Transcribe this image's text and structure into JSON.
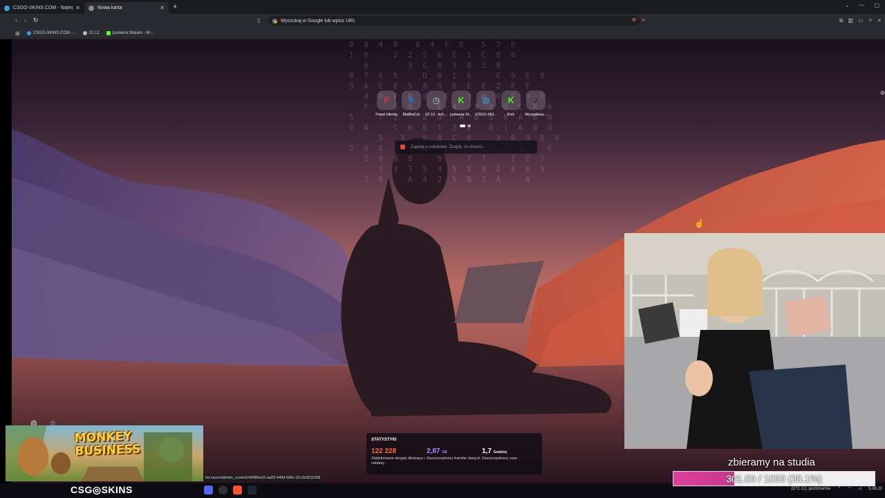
{
  "browser": {
    "tabs": [
      {
        "title": "CSGO-SKINS.COM - Najlepsze Skrzy...",
        "color": "#3ba0e0"
      },
      {
        "title": "Nowa karta",
        "color": "#888888"
      }
    ],
    "address_placeholder": "Wyszukaj w Google lub wpisz URL",
    "bookmarks": [
      {
        "label": "CSGO-SKINS.COM -...",
        "color": "#3ba0e0"
      },
      {
        "label": "22.12",
        "color": "#bbbbbb"
      },
      {
        "label": "justwera Stream - W...",
        "color": "#53fc18"
      }
    ]
  },
  "newtab": {
    "shortcuts": [
      {
        "label": "Panel klienta",
        "glyph": "P",
        "color": "#d9344a"
      },
      {
        "label": "BlaBlaCar",
        "glyph": "b",
        "color": "#1e7bd8"
      },
      {
        "label": "22.12 - lich...",
        "glyph": "◷",
        "color": "#9aa0a8"
      },
      {
        "label": "justwera St...",
        "glyph": "K",
        "color": "#53fc18"
      },
      {
        "label": "CSGO-SKI...",
        "glyph": "◎",
        "color": "#3ba0e0"
      },
      {
        "label": "Kick",
        "glyph": "K",
        "color": "#53fc18"
      },
      {
        "label": "Wyszukiwa...",
        "glyph": "♪",
        "color": "#111111"
      }
    ],
    "search_placeholder": "Zapytaj o cokolwiek. Znajdź, co chcesz...",
    "stats": {
      "heading": "STATYSTYKI",
      "items": [
        {
          "value": "122 228",
          "unit": "",
          "desc": "Zablokowane skrypty śledzące i reklamy",
          "color": "#ff6a2a"
        },
        {
          "value": "2,87",
          "unit": "GB",
          "desc": "Zaoszczędzony transfer danych",
          "color": "#a48bff"
        },
        {
          "value": "1,7",
          "unit": "Godziny",
          "desc": "Zaoszczędzony czas",
          "color": "#ffffff"
        }
      ]
    }
  },
  "ad": {
    "title_line1": "MONKEY",
    "title_line2": "BUSINESS"
  },
  "status_url": "leo-launch&mtm_content=bf086a15-aa03-449d-9d5c-01c3c9211938",
  "brand_logo": {
    "left": "CSG",
    "right": "SKINS"
  },
  "goal": {
    "title": "zbieramy na studia",
    "text": "301.00 / 1000 (30.1%)",
    "fraction": 0.301
  },
  "tray": {
    "weather": "22°C",
    "weather_desc": "Cz. pochmurnie",
    "date": "5.08.20"
  }
}
